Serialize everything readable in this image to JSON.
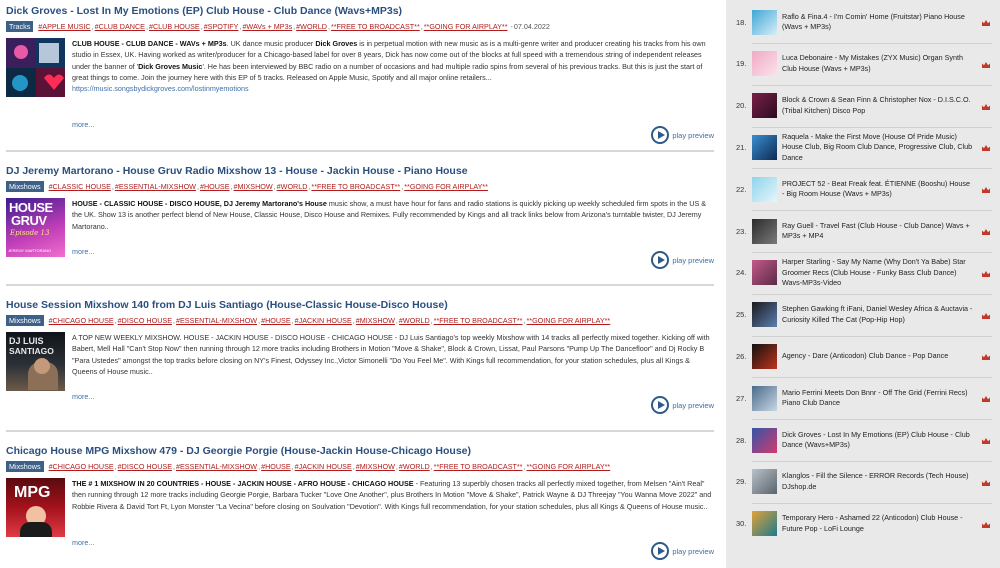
{
  "posts": [
    {
      "title": "Dick Groves - Lost In My Emotions (EP) Club House - Club Dance (Wavs+MP3s)",
      "category": "Tracks",
      "tags": [
        "#APPLE MUSIC",
        "#CLUB DANCE",
        "#CLUB HOUSE",
        "#SPOTIFY",
        "#WAVs + MP3s",
        "#WORLD",
        "**FREE TO BROADCAST**",
        "**GOING FOR AIRPLAY**"
      ],
      "date": "07.04.2022",
      "excerpt_lead": "CLUB HOUSE - CLUB DANCE - WAVs + MP3s",
      "excerpt_1": ". UK dance music producer ",
      "excerpt_bold_1": "Dick Groves",
      "excerpt_2": " is in perpetual motion with new music as is a multi-genre writer and producer creating his tracks from his own studio in Essex, UK. Having worked as writer/producer for a Chicago-based label for over 8 years, Dick has now come out of the blocks at full speed with a tremendous string of independent releases under the banner of '",
      "excerpt_bold_2": "Dick Groves Music",
      "excerpt_3": "'. He has been interviewed by BBC radio on a number of occasions and had multiple radio spins from several of his previous tracks. But this is just the start of great things to come. Join the journey here with this EP of 5 tracks. Released on Apple Music, Spotify and all major online retailers...",
      "url": "https://music.songsbydickgroves.com/lostinmyemotions",
      "more": "more...",
      "play": "play preview"
    },
    {
      "title": "DJ Jeremy Martorano - House Gruv Radio Mixshow 13 - House - Jackin House - Piano House",
      "category": "Mixshows",
      "tags": [
        "#CLASSIC HOUSE",
        "#ESSENTIAL-MIXSHOW",
        "#HOUSE",
        "#MIXSHOW",
        "#WORLD",
        "**FREE TO BROADCAST**",
        "**GOING FOR AIRPLAY**"
      ],
      "excerpt_lead": "HOUSE - CLASSIC HOUSE - DISCO HOUSE, DJ Jeremy Martorano's House",
      "excerpt_1": " music show, a must have hour for fans and radio stations is quickly picking up weekly scheduled firm spots in the US & the UK. Show 13 is another perfect blend of New House, Classic House, Disco House and Remixes. Fully recommended by Kings and all track links below from Arizona's turntable twister, DJ Jeremy Martorano..",
      "thumb_text_1": "HOUSE",
      "thumb_text_2": "GRUV",
      "thumb_text_3": "Episode 13",
      "thumb_text_4": "JEREMY MARTORANO",
      "more": "more...",
      "play": "play preview"
    },
    {
      "title": "House Session Mixshow 140 from DJ Luis Santiago (House-Classic House-Disco House)",
      "category": "Mixshows",
      "tags": [
        "#CHICAGO HOUSE",
        "#DISCO HOUSE",
        "#ESSENTIAL-MIXSHOW",
        "#HOUSE",
        "#JACKIN HOUSE",
        "#MIXSHOW",
        "#WORLD",
        "**FREE TO BROADCAST**",
        "**GOING FOR AIRPLAY**"
      ],
      "excerpt_1": "A TOP NEW WEEKLY MIXSHOW. HOUSE - JACKIN HOUSE - DISCO HOUSE - CHICAGO HOUSE - DJ Luis Santiago's top weekly Mixshow with 14 tracks all perfectly mixed together. Kicking off with Babert, Mell Hall \"Can't Stop Now\" then running through 12 more tracks including Brothers in Motion \"Move & Shake\", Block & Crown, Lissat, Paul Parsons \"Pump Up The Dancefloor\" and Dj Rocky B \"Para Ustedes\" amongst the top tracks before closing on NY's Finest, Odyssey Inc.,Victor Simonelli \"Do You Feel Me\". With Kings full recommendation, for your station schedules, plus all Kings & Queens of House music..",
      "thumb_text_1": "DJ LUIS",
      "thumb_text_2": "SANTIAGO",
      "more": "more...",
      "play": "play preview"
    },
    {
      "title": "Chicago House MPG Mixshow 479 - DJ Georgie Porgie (House-Jackin House-Chicago House)",
      "category": "Mixshows",
      "tags": [
        "#CHICAGO HOUSE",
        "#DISCO HOUSE",
        "#ESSENTIAL-MIXSHOW",
        "#HOUSE",
        "#JACKIN HOUSE",
        "#MIXSHOW",
        "#WORLD",
        "**FREE TO BROADCAST**",
        "**GOING FOR AIRPLAY**"
      ],
      "excerpt_lead": "THE # 1 MIXSHOW IN 20 COUNTRIES - HOUSE - JACKIN HOUSE - AFRO HOUSE - CHICAGO HOUSE",
      "excerpt_1": " - Featuring 13 superbly chosen tracks all perfectly mixed together, from Melsen \"Ain't Real\" then running through 12 more tracks including Georgie Porgie, Barbara Tucker \"Love One Another\", plus Brothers In Motion \"Move & Shake\", Patrick Wayne & DJ Threejay \"You Wanna Move 2022\" and Robbie Rivera & David Tort Ft, Lyon Monster \"La Vecina\" before closing on Soulvation \"Devotion\". With Kings full recommendation, for your station schedules, plus all Kings & Queens of House music..",
      "thumb_text_1": "MPG",
      "more": "more...",
      "play": "play preview"
    }
  ],
  "chart": [
    {
      "rank": "18.",
      "text": "Raflo & Fina.4 - I'm Comin' Home (Fruitstar) Piano House (Wavs + MP3s)",
      "colors": [
        "#3fa7d6",
        "#d7eef7"
      ]
    },
    {
      "rank": "19.",
      "text": "Luca Debonaire - My Mistakes (ZYX Music) Organ Synth Club House (Wavs + MP3s)",
      "colors": [
        "#f0a9c4",
        "#fbe3ec"
      ]
    },
    {
      "rank": "20.",
      "text": "Block & Crown & Sean Finn & Christopher Nox - D.I.S.C.O. (Tribal Kitchen) Disco Pop",
      "colors": [
        "#7a1f4b",
        "#2b0d1d"
      ]
    },
    {
      "rank": "21.",
      "text": "Raquela - Make the First Move (House Of Pride Music) House Club, Big Room Club Dance, Progressive Club, Club Dance",
      "colors": [
        "#3a8fd0",
        "#0d2a52"
      ]
    },
    {
      "rank": "22.",
      "text": "PROJECT 52 - Beat Freak feat. ÉTIENNE (Booshu) House - Big Room House (Wavs + MP3s)",
      "colors": [
        "#8fd3ec",
        "#e6f6fb"
      ]
    },
    {
      "rank": "23.",
      "text": "Ray Guell - Travel Fast (Club House - Club Dance) Wavs + MP3s + MP4",
      "colors": [
        "#2b2b2b",
        "#7a7a7a"
      ]
    },
    {
      "rank": "24.",
      "text": "Harper Starling - Say My Name (Why Don't Ya Babe) Star Groomer Recs (Club House - Funky Bass Club Dance) Wavs-MP3s-Video",
      "colors": [
        "#c45a8a",
        "#5a2b48"
      ]
    },
    {
      "rank": "25.",
      "text": "Stephen Gawking ft iFani, Daniel Wesley Africa & Auctavia - Curiosity Killed The Cat (Pop-Hip Hop)",
      "colors": [
        "#1a1a1a",
        "#5c7fb2"
      ]
    },
    {
      "rank": "26.",
      "text": "Agency - Dare (Anticodon) Club Dance - Pop Dance",
      "colors": [
        "#111111",
        "#c0341d"
      ]
    },
    {
      "rank": "27.",
      "text": "Mario Ferrini Meets Don Bnnr - Off The Grid (Ferrini Recs) Piano Club Dance",
      "colors": [
        "#4a6a8a",
        "#c7d7e4"
      ]
    },
    {
      "rank": "28.",
      "text": "Dick Groves - Lost In My Emotions (EP) Club House - Club Dance (Wavs+MP3s)",
      "colors": [
        "#3355a8",
        "#d23a6e"
      ]
    },
    {
      "rank": "29.",
      "text": "Klanglos - Fill the Silence - ERROR Records (Tech House) DJshop.de",
      "colors": [
        "#b9c2c9",
        "#5a646c"
      ]
    },
    {
      "rank": "30.",
      "text": "Temporary Hero - Ashamed 22 (Anticodon) Club House - Future Pop - LoFi Lounge",
      "colors": [
        "#e2a13a",
        "#1d7a8c"
      ]
    }
  ],
  "colors": {
    "accent": "#2b4f7f",
    "tag_red": "#b21c1c",
    "crown_red": "#c0392b",
    "sidebar_bg": "#e9e9e9"
  }
}
